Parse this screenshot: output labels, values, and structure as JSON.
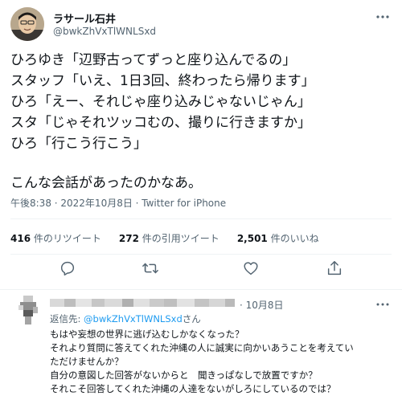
{
  "tweet": {
    "display_name": "ラサール石井",
    "handle": "@bwkZhVxTlWNLSxd",
    "lines": [
      "ひろゆき「辺野古ってずっと座り込んでるの」",
      "スタッフ「いえ、1日3回、終わったら帰ります」",
      "ひろ「えー、それじゃ座り込みじゃないじゃん」",
      "スタ「じゃそれツッコむの、撮りに行きますか」",
      "ひろ「行こう行こう」"
    ],
    "closing_line": "こんな会話があったのかなあ。",
    "meta": "午後8:38 · 2022年10月8日 · Twitter for iPhone",
    "stats": {
      "retweets_value": "416",
      "retweets_label": "件のリツイート",
      "quotes_value": "272",
      "quotes_label": "件の引用ツイート",
      "likes_value": "2,501",
      "likes_label": "件のいいね"
    },
    "actions": [
      "reply-icon",
      "retweet-icon",
      "like-icon",
      "share-icon"
    ]
  },
  "reply": {
    "date": "· 10月8日",
    "reply_prefix": "返信先: ",
    "reply_mention": "@bwkZhVxTlWNLSxd",
    "reply_suffix": "さん",
    "lines": [
      "もはや妄想の世界に逃げ込むしかなくなった？",
      "それより質問に答えてくれた沖縄の人に誠実に向かいあうことを考えてい",
      "ただけませんか？",
      "自分の意図した回答がないからと　聞きっぱなしで放置ですか？",
      "それこそ回答してくれた沖縄の人達をないがしろにしているのでは？"
    ]
  },
  "colors": {
    "text": "#0f1419",
    "secondary": "#536471",
    "link": "#1d9bf0",
    "divider": "#eff3f4"
  }
}
